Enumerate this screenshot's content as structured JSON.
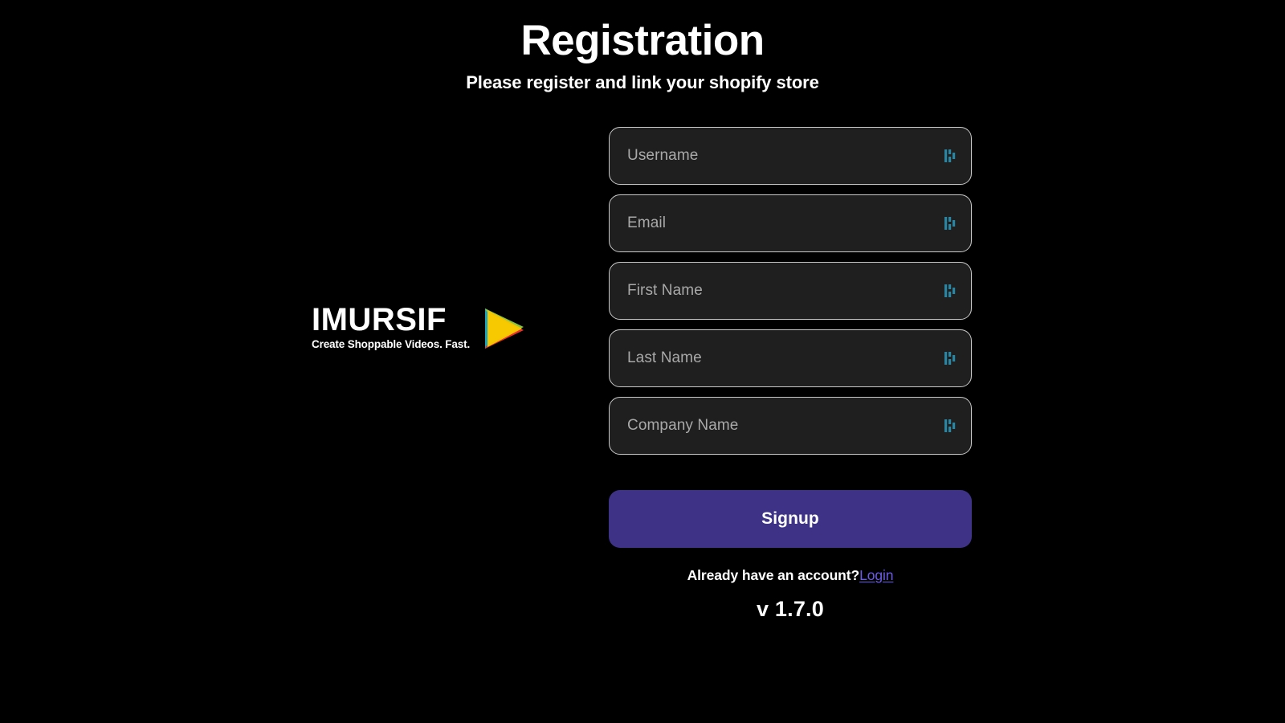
{
  "header": {
    "title": "Registration",
    "subtitle": "Please register and link your shopify store"
  },
  "brand": {
    "wordmark": "IMURSIF",
    "tagline": "Create Shoppable Videos. Fast.",
    "play_icon_colors": {
      "left_edge": "#18a5c4",
      "top_edge": "#86c440",
      "bottom_edge": "#e8312a",
      "center": "#f5c400"
    }
  },
  "form": {
    "fields": [
      {
        "name": "username",
        "placeholder": "Username",
        "value": ""
      },
      {
        "name": "email",
        "placeholder": "Email",
        "value": ""
      },
      {
        "name": "first_name",
        "placeholder": "First Name",
        "value": ""
      },
      {
        "name": "last_name",
        "placeholder": "Last Name",
        "value": ""
      },
      {
        "name": "company_name",
        "placeholder": "Company Name",
        "value": ""
      }
    ],
    "badge_icon": "autofill-badge-icon",
    "badge_color": "#2a8ba8",
    "submit_label": "Signup",
    "submit_color": "#3e3287"
  },
  "footer": {
    "account_prompt": "Already have an account?",
    "login_label": "Login",
    "login_color": "#6b5ce7",
    "version": "v 1.7.0"
  },
  "theme": {
    "background": "#000000",
    "field_background": "#1f1f1f",
    "field_border": "#c9c9c9",
    "placeholder_color": "#a9a9a9",
    "text_color": "#ffffff"
  }
}
